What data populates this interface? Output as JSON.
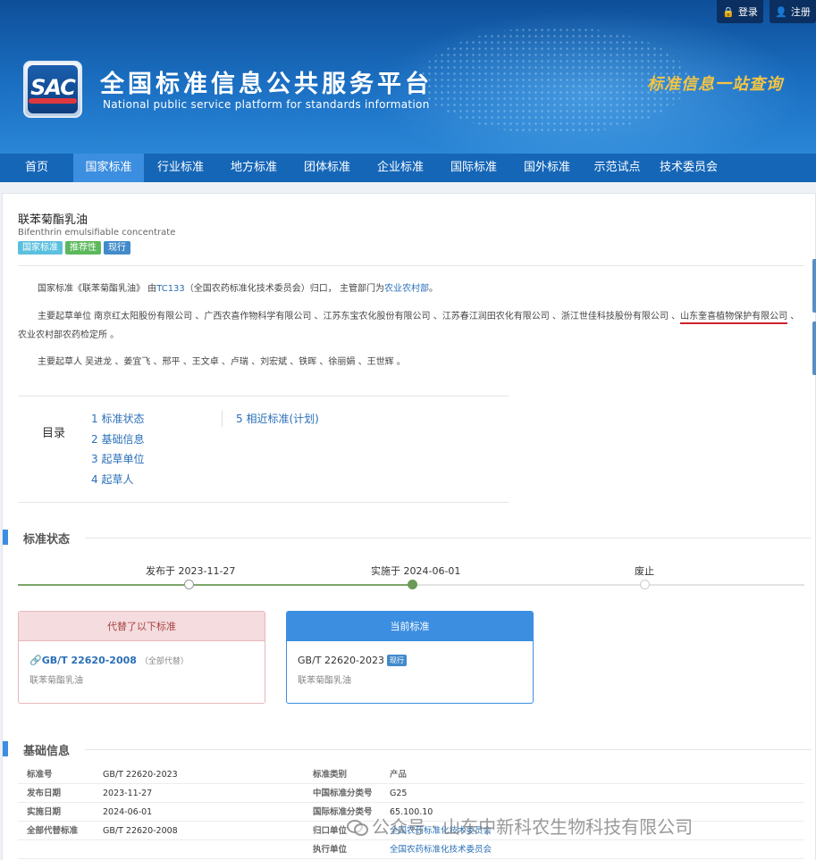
{
  "header": {
    "login": "登录",
    "register": "注册",
    "logo_text": "SAC",
    "title": "全国标准信息公共服务平台",
    "subtitle": "National public service platform  for standards information",
    "slogan": "标准信息一站查询"
  },
  "nav": [
    {
      "label": "首页",
      "width": 82
    },
    {
      "label": "国家标准",
      "width": 79,
      "active": true
    },
    {
      "label": "行业标准",
      "width": 82
    },
    {
      "label": "地方标准",
      "width": 82
    },
    {
      "label": "团体标准",
      "width": 82
    },
    {
      "label": "企业标准",
      "width": 82
    },
    {
      "label": "国际标准",
      "width": 82
    },
    {
      "label": "国外标准",
      "width": 82
    },
    {
      "label": "示范试点",
      "width": 75
    },
    {
      "label": "技术委员会",
      "width": 85
    }
  ],
  "standard": {
    "title": "联苯菊酯乳油",
    "title_en": "Bifenthrin emulsifiable concentrate",
    "tags": [
      "国家标准",
      "推荐性",
      "现行"
    ]
  },
  "intro": {
    "p1_a": "国家标准《联苯菊酯乳油》 由",
    "p1_tc": "TC133",
    "p1_b": "（全国农药标准化技术委员会）归口， 主管部门为",
    "p1_dept": "农业农村部",
    "p1_c": "。",
    "p2_a": "主要起草单位 南京红太阳股份有限公司 、广西农喜作物科学有限公司 、江苏东宝农化股份有限公司 、江苏春江润田农化有限公司 、浙江世佳科技股份有限公司 、",
    "p2_highlight": "山东奎喜植物保护有限公司",
    "p2_b": " 、农业农村部农药检定所 。",
    "p3": "主要起草人 吴进龙 、姜宜飞 、邢平 、王文卓 、卢瑞 、刘宏斌 、铁晖 、徐丽娟 、王世辉 。"
  },
  "toc": {
    "label": "目录",
    "items_left": [
      "1  标准状态",
      "2  基础信息",
      "3  起草单位",
      "4  起草人"
    ],
    "items_right": [
      "5  相近标准(计划)"
    ]
  },
  "status": {
    "heading": "标准状态",
    "timeline": [
      {
        "label": "发布于 2023-11-27",
        "state": "done"
      },
      {
        "label": "实施于 2024-06-01",
        "state": "current"
      },
      {
        "label": "废止",
        "state": "pending"
      }
    ],
    "replaced": {
      "header": "代替了以下标准",
      "code": "GB/T 22620-2008",
      "note": "（全部代替）",
      "name": "联苯菊酯乳油"
    },
    "current": {
      "header": "当前标准",
      "code": "GB/T 22620-2023",
      "badge": "现行",
      "name": "联苯菊酯乳油"
    }
  },
  "basic": {
    "heading": "基础信息",
    "rows": [
      {
        "k1": "标准号",
        "v1": "GB/T 22620-2023",
        "k2": "标准类别",
        "v2": "产品"
      },
      {
        "k1": "发布日期",
        "v1": "2023-11-27",
        "k2": "中国标准分类号",
        "v2": "G25"
      },
      {
        "k1": "实施日期",
        "v1": "2024-06-01",
        "k2": "国际标准分类号",
        "v2": "65.100.10"
      },
      {
        "k1": "全部代替标准",
        "v1": "GB/T 22620-2008",
        "k2": "归口单位",
        "v2": "全国农药标准化技术委员会"
      },
      {
        "k1": "",
        "v1": "",
        "k2": "执行单位",
        "v2": "全国农药标准化技术委员会"
      }
    ]
  },
  "watermark": "公众号 · 山东中新科农生物科技有限公司"
}
